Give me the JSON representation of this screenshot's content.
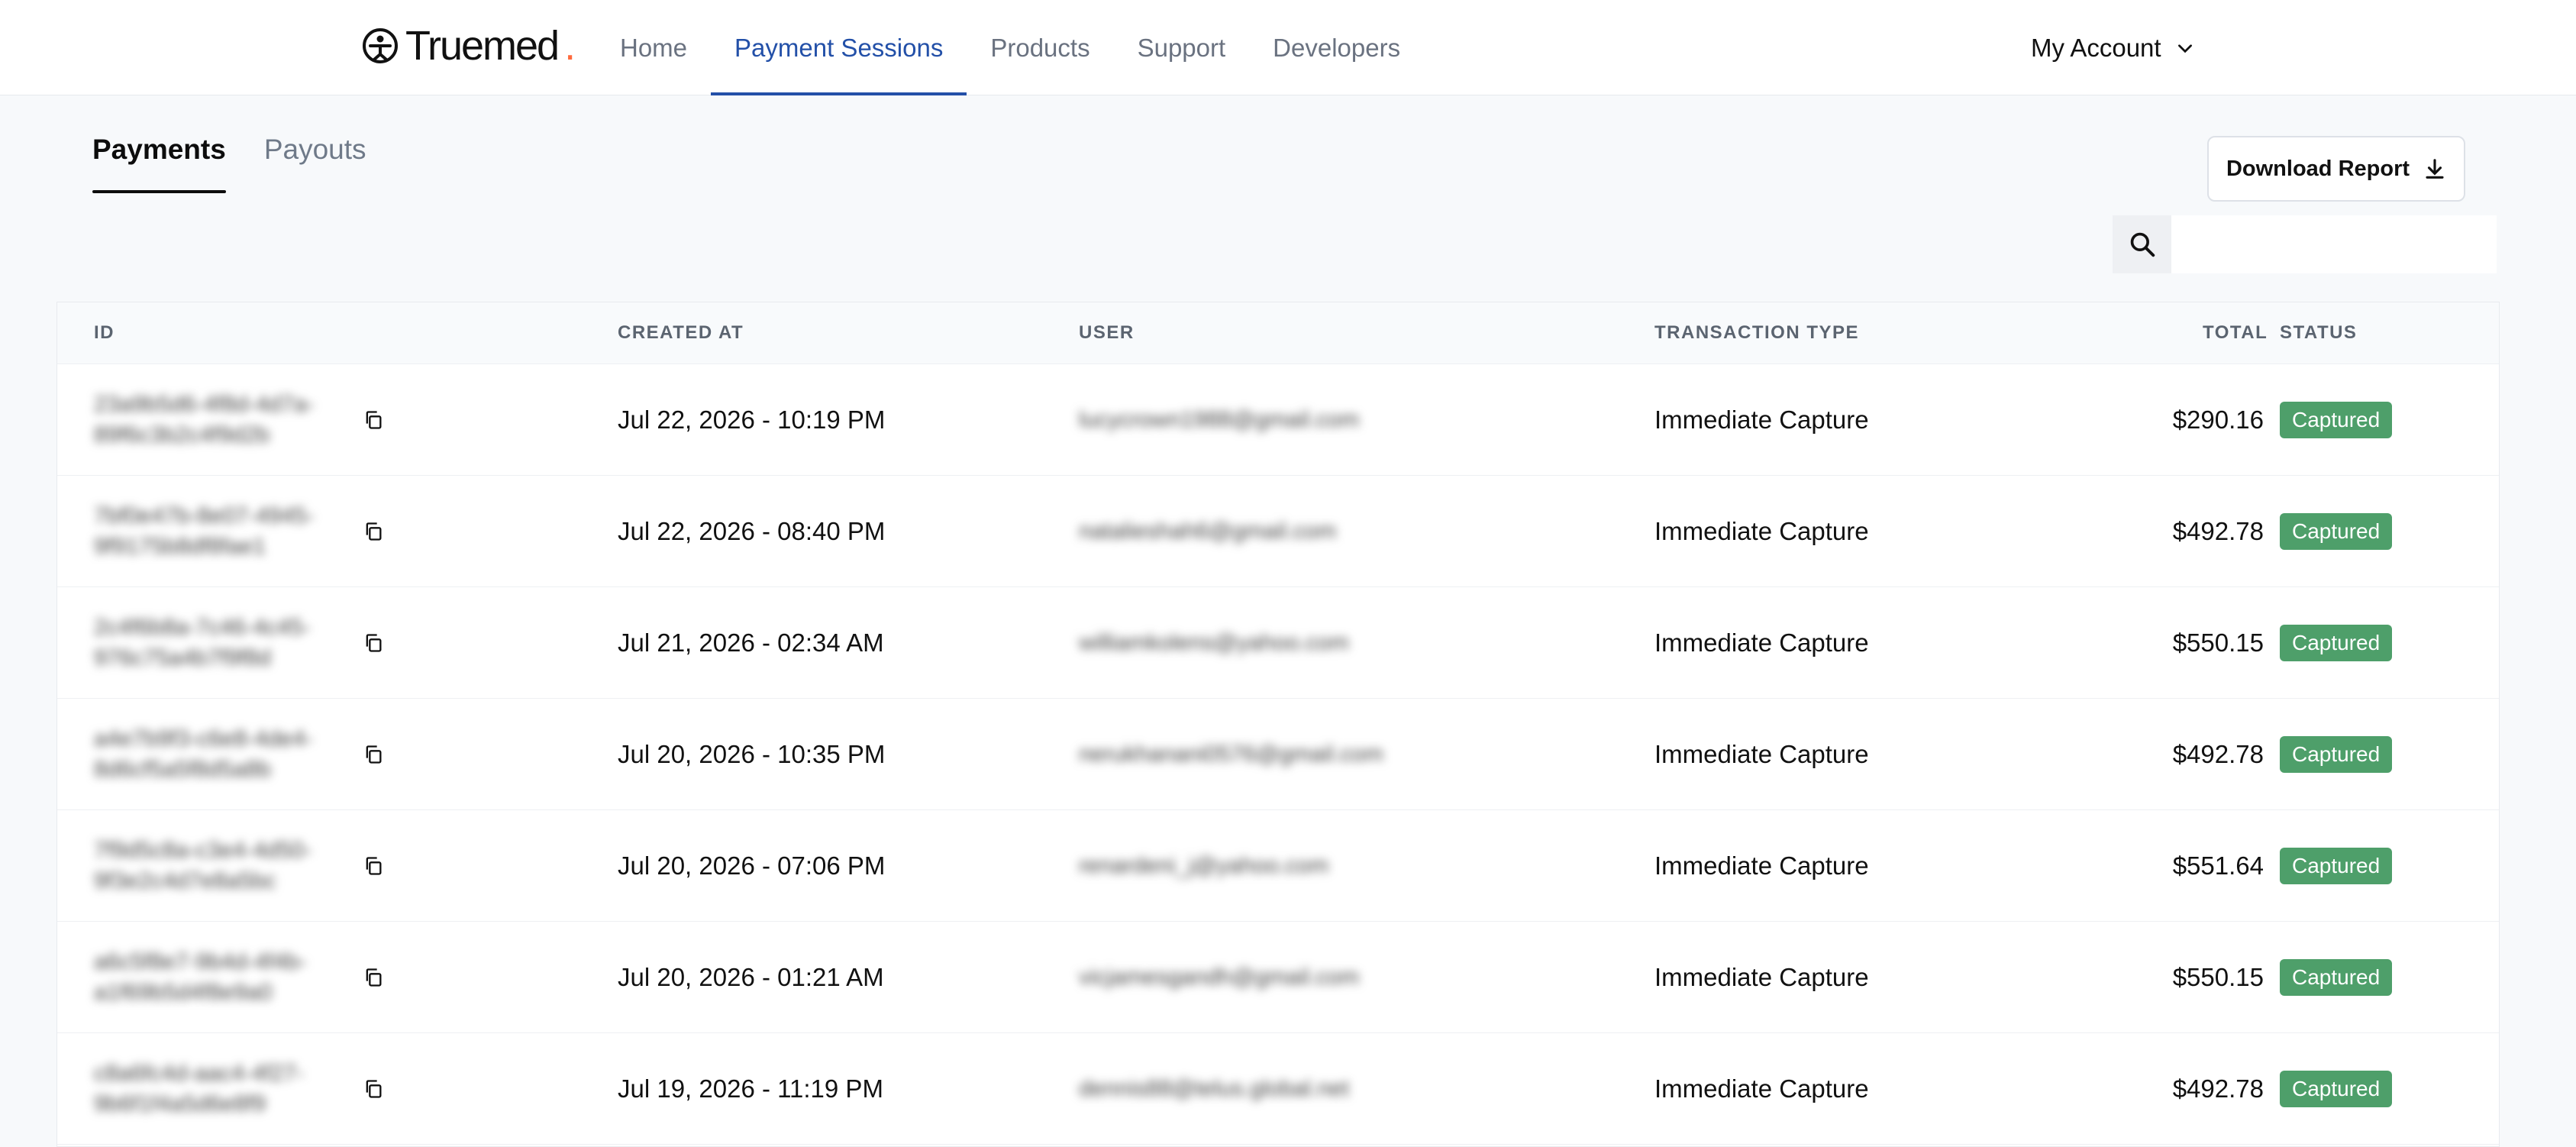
{
  "brand": {
    "name": "Truemed",
    "accent": "#2350a8"
  },
  "nav": {
    "items": [
      "Home",
      "Payment Sessions",
      "Products",
      "Support",
      "Developers"
    ],
    "active_index": 1,
    "account_label": "My Account"
  },
  "tabs": {
    "items": [
      "Payments",
      "Payouts"
    ],
    "active_index": 0
  },
  "toolbar": {
    "download_label": "Download Report"
  },
  "search": {
    "placeholder": ""
  },
  "table": {
    "columns": [
      "ID",
      "CREATED AT",
      "USER",
      "TRANSACTION TYPE",
      "TOTAL",
      "STATUS"
    ],
    "rows": [
      {
        "id": "23a9b5d6-4f8d-4d7a-89f6c3b2c4f9d2b",
        "created_at": "Jul 22, 2026 - 10:19 PM",
        "user": "lucycrown1988@gmail.com",
        "transaction_type": "Immediate Capture",
        "total": "$290.16",
        "status": "Captured"
      },
      {
        "id": "7bf0e47b-8e07-4945-9f9175b8df8fae1",
        "created_at": "Jul 22, 2026 - 08:40 PM",
        "user": "natalieshah6@gmail.com",
        "transaction_type": "Immediate Capture",
        "total": "$492.78",
        "status": "Captured"
      },
      {
        "id": "2c4f6b8a-7c46-4c45-976c75a4b7f9f8d",
        "created_at": "Jul 21, 2026 - 02:34 AM",
        "user": "williamkolens@yahoo.com",
        "transaction_type": "Immediate Capture",
        "total": "$550.15",
        "status": "Captured"
      },
      {
        "id": "a4e7b9f3-c6e8-4de4-8d6cf5a5f8d5a8b",
        "created_at": "Jul 20, 2026 - 10:35 PM",
        "user": "nerukhanani0576@gmail.com",
        "transaction_type": "Immediate Capture",
        "total": "$492.78",
        "status": "Captured"
      },
      {
        "id": "7f9d5c8a-c3e4-4d50-9f3e2c4d7e8a5bc",
        "created_at": "Jul 20, 2026 - 07:06 PM",
        "user": "renardeni_j@yahoo.com",
        "transaction_type": "Immediate Capture",
        "total": "$551.64",
        "status": "Captured"
      },
      {
        "id": "a6c5f8e7-9b4d-4f4b-a1f69b5d4f8e9a0",
        "created_at": "Jul 20, 2026 - 01:21 AM",
        "user": "vicjamesgandh@gmail.com",
        "transaction_type": "Immediate Capture",
        "total": "$550.15",
        "status": "Captured"
      },
      {
        "id": "c8a6fc4d-aac4-4f27-9b6f1f4a5d6e8f9",
        "created_at": "Jul 19, 2026 - 11:19 PM",
        "user": "dennis88@telus.global.net",
        "transaction_type": "Immediate Capture",
        "total": "$492.78",
        "status": "Captured"
      }
    ]
  },
  "colors": {
    "captured_badge": "#4e9f6a"
  }
}
